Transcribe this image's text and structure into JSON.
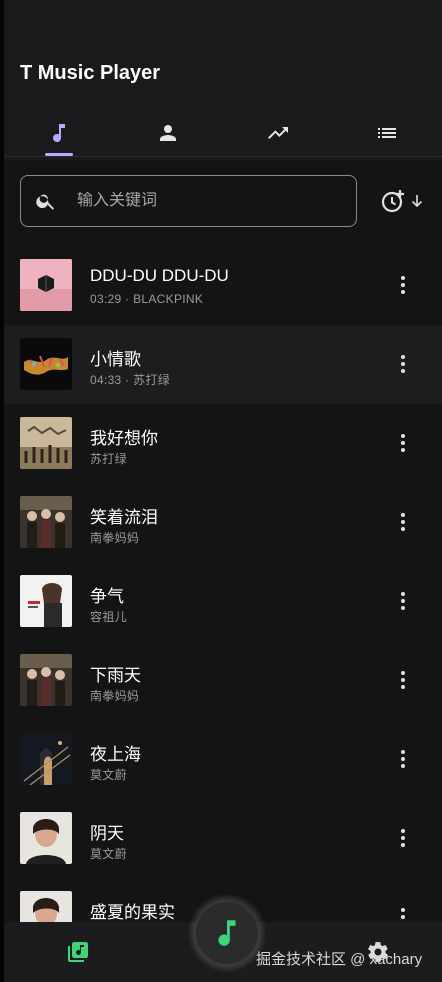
{
  "app": {
    "title": "T Music Player",
    "accent": "#b9a9ff",
    "fab_color": "#3fd47a"
  },
  "tabs": [
    {
      "icon": "music-note-icon",
      "active": true
    },
    {
      "icon": "person-icon",
      "active": false
    },
    {
      "icon": "trending-up-icon",
      "active": false
    },
    {
      "icon": "list-icon",
      "active": false
    }
  ],
  "search": {
    "placeholder": "输入关键词",
    "value": ""
  },
  "songs": [
    {
      "title": "DDU-DU DDU-DU",
      "duration": "03:29",
      "artist": "BLACKPINK",
      "sub": "03:29  ·  BLACKPINK"
    },
    {
      "title": "小情歌",
      "duration": "04:33",
      "artist": "苏打绿",
      "sub": "04:33  ·  苏打绿"
    },
    {
      "title": "我好想你",
      "duration": "",
      "artist": "苏打绿",
      "sub": "苏打绿"
    },
    {
      "title": "笑着流泪",
      "duration": "",
      "artist": "南拳妈妈",
      "sub": "南拳妈妈"
    },
    {
      "title": "争气",
      "duration": "",
      "artist": "容祖儿",
      "sub": "容祖儿"
    },
    {
      "title": "下雨天",
      "duration": "",
      "artist": "南拳妈妈",
      "sub": "南拳妈妈"
    },
    {
      "title": "夜上海",
      "duration": "",
      "artist": "莫文蔚",
      "sub": "莫文蔚"
    },
    {
      "title": "阴天",
      "duration": "",
      "artist": "莫文蔚",
      "sub": "莫文蔚"
    },
    {
      "title": "盛夏的果实",
      "duration": "",
      "artist": "",
      "sub": ""
    }
  ],
  "bottom": {
    "watermark": "掘金技术社区 @ xachary"
  }
}
